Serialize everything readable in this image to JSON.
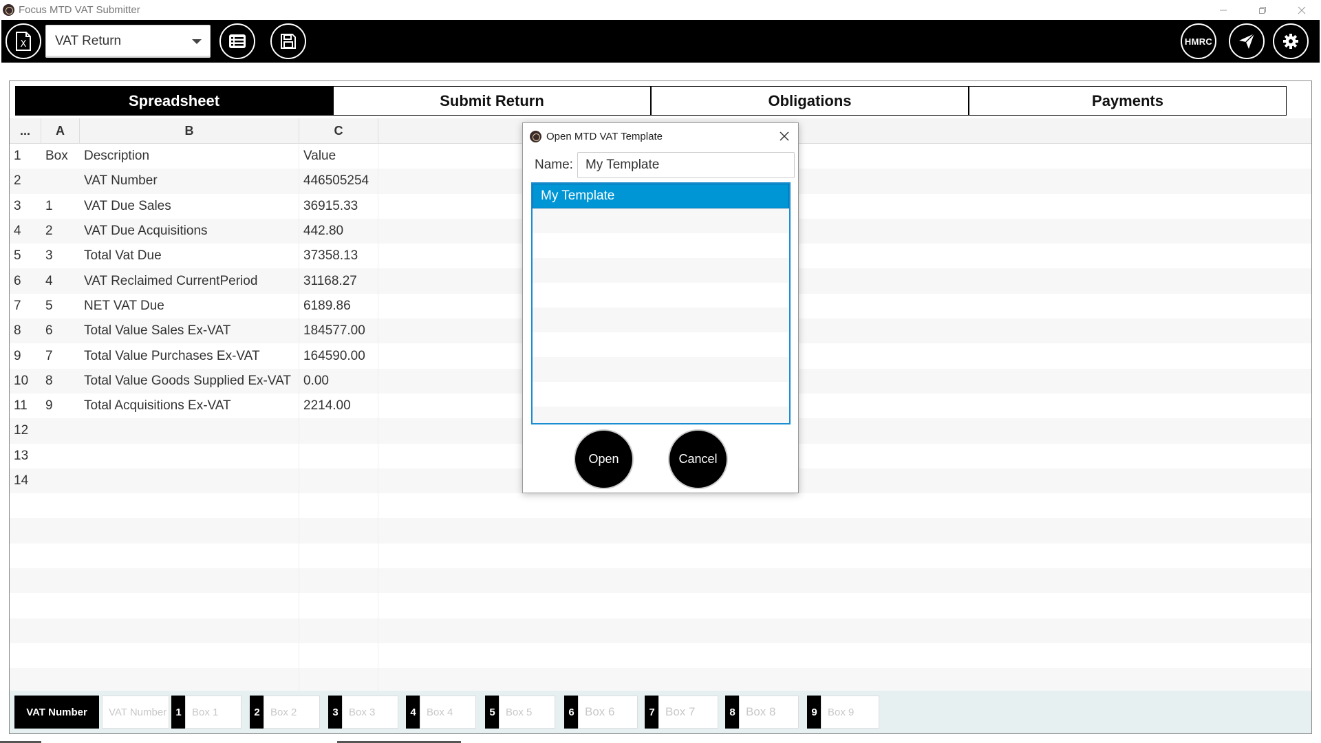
{
  "window": {
    "title": "Focus MTD VAT Submitter",
    "controls": [
      "minimize",
      "restore",
      "close"
    ]
  },
  "toolbar": {
    "dropdown_value": "VAT Return",
    "hmrc_label": "HMRC",
    "icons": [
      "excel-file-icon",
      "list-icon",
      "save-icon",
      "hmrc-icon",
      "send-icon",
      "settings-icon"
    ]
  },
  "tabs": [
    {
      "label": "Spreadsheet",
      "active": true
    },
    {
      "label": "Submit Return",
      "active": false
    },
    {
      "label": "Obligations",
      "active": false
    },
    {
      "label": "Payments",
      "active": false
    }
  ],
  "grid": {
    "columns": [
      "...",
      "A",
      "B",
      "C"
    ],
    "rows": [
      {
        "n": "1",
        "a": "Box",
        "b": "Description",
        "c": "Value"
      },
      {
        "n": "2",
        "a": "",
        "b": "VAT Number",
        "c": "446505254"
      },
      {
        "n": "3",
        "a": "1",
        "b": "VAT Due Sales",
        "c": "36915.33"
      },
      {
        "n": "4",
        "a": "2",
        "b": "VAT Due Acquisitions",
        "c": "442.80"
      },
      {
        "n": "5",
        "a": "3",
        "b": "Total Vat Due",
        "c": "37358.13"
      },
      {
        "n": "6",
        "a": "4",
        "b": "VAT Reclaimed CurrentPeriod",
        "c": "31168.27"
      },
      {
        "n": "7",
        "a": "5",
        "b": "NET VAT Due",
        "c": "6189.86"
      },
      {
        "n": "8",
        "a": "6",
        "b": " Total Value Sales Ex-VAT",
        "c": "184577.00"
      },
      {
        "n": "9",
        "a": "7",
        "b": "Total Value Purchases Ex-VAT",
        "c": "164590.00"
      },
      {
        "n": "10",
        "a": "8",
        "b": "Total Value Goods Supplied Ex-VAT",
        "c": "0.00"
      },
      {
        "n": "11",
        "a": "9",
        "b": "Total Acquisitions Ex-VAT",
        "c": "2214.00"
      },
      {
        "n": "12",
        "a": "",
        "b": "",
        "c": ""
      },
      {
        "n": "13",
        "a": "",
        "b": "",
        "c": ""
      },
      {
        "n": "14",
        "a": "",
        "b": "",
        "c": ""
      },
      {
        "n": "",
        "a": "",
        "b": "",
        "c": ""
      },
      {
        "n": "",
        "a": "",
        "b": "",
        "c": ""
      },
      {
        "n": "",
        "a": "",
        "b": "",
        "c": ""
      },
      {
        "n": "",
        "a": "",
        "b": "",
        "c": ""
      },
      {
        "n": "",
        "a": "",
        "b": "",
        "c": ""
      },
      {
        "n": "",
        "a": "",
        "b": "",
        "c": ""
      },
      {
        "n": "",
        "a": "",
        "b": "",
        "c": ""
      },
      {
        "n": "",
        "a": "",
        "b": "",
        "c": ""
      }
    ]
  },
  "bottom_bar": {
    "vat_label": "VAT Number",
    "vat_placeholder": "VAT Number",
    "boxes": [
      {
        "num": "1",
        "placeholder": "Box 1"
      },
      {
        "num": "2",
        "placeholder": "Box 2"
      },
      {
        "num": "3",
        "placeholder": "Box 3"
      },
      {
        "num": "4",
        "placeholder": "Box 4"
      },
      {
        "num": "5",
        "placeholder": "Box 5"
      },
      {
        "num": "6",
        "placeholder": "Box 6"
      },
      {
        "num": "7",
        "placeholder": "Box 7"
      },
      {
        "num": "8",
        "placeholder": "Box 8"
      },
      {
        "num": "9",
        "placeholder": "Box 9"
      }
    ]
  },
  "dialog": {
    "title": "Open MTD VAT Template",
    "name_label": "Name:",
    "name_value": "My Template",
    "templates": [
      "My Template"
    ],
    "open_label": "Open",
    "cancel_label": "Cancel"
  },
  "colors": {
    "toolbar_bg": "#000000",
    "selection": "#0096d6",
    "list_border": "#1a8ed0",
    "bottom_bar_bg": "#e6f0f0"
  }
}
